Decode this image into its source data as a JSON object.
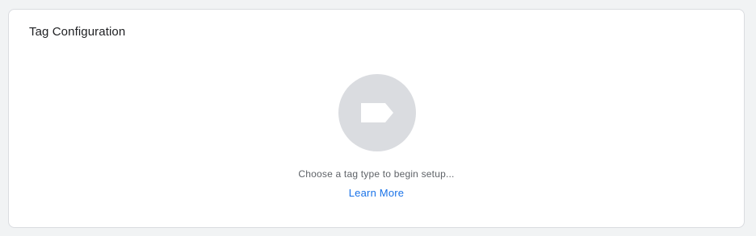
{
  "card": {
    "title": "Tag Configuration",
    "icon": "tag-icon",
    "hint": "Choose a tag type to begin setup...",
    "learn_more": "Learn More"
  },
  "colors": {
    "page_background": "#f1f3f4",
    "card_background": "#ffffff",
    "icon_circle": "#dadce0",
    "icon_fill": "#ffffff",
    "link": "#1a73e8",
    "hint_text": "#5f6368",
    "title_text": "#202124"
  }
}
